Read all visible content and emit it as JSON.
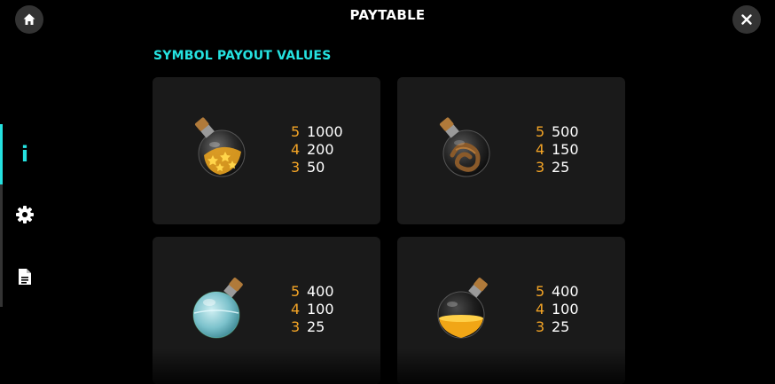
{
  "header": {
    "title": "PAYTABLE",
    "home_icon": "home-icon",
    "close_icon": "close-icon"
  },
  "sidebar": {
    "items": [
      {
        "name": "info",
        "icon": "info-icon",
        "glyph": "i",
        "active": true
      },
      {
        "name": "settings",
        "icon": "gear-icon",
        "active": false
      },
      {
        "name": "rules",
        "icon": "document-icon",
        "active": false
      }
    ]
  },
  "section": {
    "title": "SYMBOL PAYOUT VALUES"
  },
  "colors": {
    "accent": "#25e2e0",
    "count": "#f3a426",
    "card_bg": "#1a1a1a",
    "background": "#000000"
  },
  "cards": [
    {
      "symbol": "star-potion-icon",
      "payouts": [
        {
          "count": "5",
          "value": "1000"
        },
        {
          "count": "4",
          "value": "200"
        },
        {
          "count": "3",
          "value": "50"
        }
      ]
    },
    {
      "symbol": "rope-potion-icon",
      "payouts": [
        {
          "count": "5",
          "value": "500"
        },
        {
          "count": "4",
          "value": "150"
        },
        {
          "count": "3",
          "value": "25"
        }
      ]
    },
    {
      "symbol": "blue-potion-icon",
      "payouts": [
        {
          "count": "5",
          "value": "400"
        },
        {
          "count": "4",
          "value": "100"
        },
        {
          "count": "3",
          "value": "25"
        }
      ]
    },
    {
      "symbol": "gold-potion-icon",
      "payouts": [
        {
          "count": "5",
          "value": "400"
        },
        {
          "count": "4",
          "value": "100"
        },
        {
          "count": "3",
          "value": "25"
        }
      ]
    }
  ]
}
